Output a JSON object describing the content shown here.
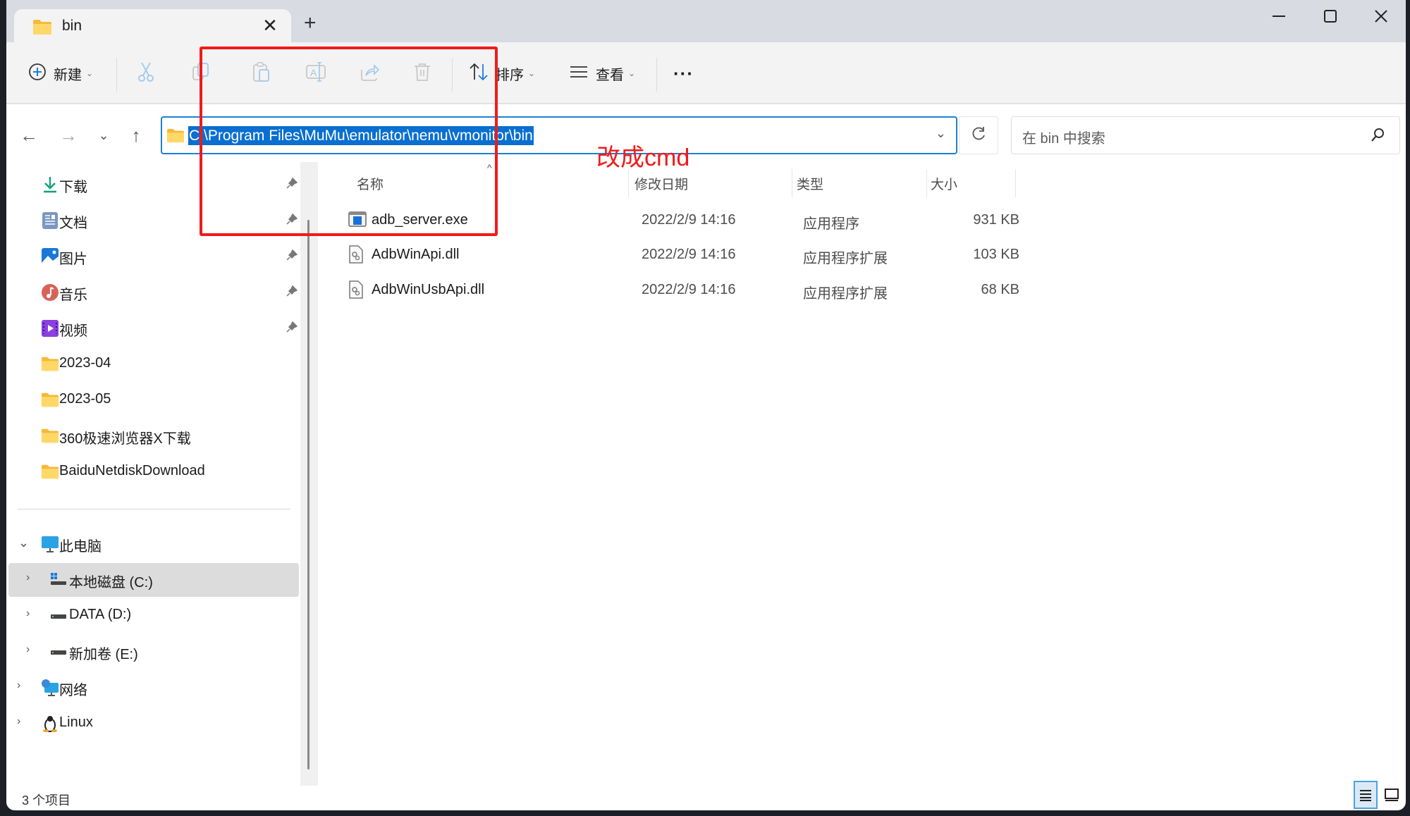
{
  "tab": {
    "title": "bin",
    "close_glyph": "✕",
    "new_glyph": "+"
  },
  "window_controls": {
    "minimize": "minimize",
    "maximize": "maximize",
    "close": "close"
  },
  "toolbar": {
    "new_label": "新建",
    "sort_label": "排序",
    "view_label": "查看",
    "more_label": "···",
    "caret": "⌄",
    "icons": [
      "cut-icon",
      "copy-icon",
      "paste-icon",
      "rename-icon",
      "share-icon",
      "delete-icon"
    ]
  },
  "nav": {
    "back": "←",
    "forward": "→",
    "recent": "⌄",
    "up": "↑",
    "address": "C:\\Program Files\\MuMu\\emulator\\nemu\\vmonitor\\bin",
    "dropdown": "⌄",
    "search_placeholder": "在 bin 中搜索"
  },
  "sidebar": {
    "quick_access": [
      {
        "label": "下载",
        "icon": "download-icon",
        "pinned": true
      },
      {
        "label": "文档",
        "icon": "documents-icon",
        "pinned": true
      },
      {
        "label": "图片",
        "icon": "pictures-icon",
        "pinned": true
      },
      {
        "label": "音乐",
        "icon": "music-icon",
        "pinned": true
      },
      {
        "label": "视频",
        "icon": "videos-icon",
        "pinned": true
      },
      {
        "label": "2023-04",
        "icon": "folder-icon",
        "pinned": false
      },
      {
        "label": "2023-05",
        "icon": "folder-icon",
        "pinned": false
      },
      {
        "label": "360极速浏览器X下载",
        "icon": "folder-icon",
        "pinned": false
      },
      {
        "label": "BaiduNetdiskDownload",
        "icon": "folder-icon",
        "pinned": false
      }
    ],
    "this_pc": {
      "label": "此电脑",
      "expanded": true
    },
    "drives": [
      {
        "label": "本地磁盘 (C:)",
        "selected": true
      },
      {
        "label": "DATA (D:)",
        "selected": false
      },
      {
        "label": "新加卷 (E:)",
        "selected": false
      }
    ],
    "network": {
      "label": "网络"
    },
    "linux": {
      "label": "Linux"
    }
  },
  "columns": {
    "name": "名称",
    "modified": "修改日期",
    "type": "类型",
    "size": "大小"
  },
  "files": [
    {
      "name": "adb_server.exe",
      "modified": "2022/2/9 14:16",
      "type": "应用程序",
      "size": "931 KB",
      "icon": "exe-icon"
    },
    {
      "name": "AdbWinApi.dll",
      "modified": "2022/2/9 14:16",
      "type": "应用程序扩展",
      "size": "103 KB",
      "icon": "dll-icon"
    },
    {
      "name": "AdbWinUsbApi.dll",
      "modified": "2022/2/9 14:16",
      "type": "应用程序扩展",
      "size": "68 KB",
      "icon": "dll-icon"
    }
  ],
  "status": {
    "item_count": "3 个项目"
  },
  "annotation": {
    "text": "改成cmd",
    "color": "#f11a1a"
  },
  "colors": {
    "accent": "#0a6fd0",
    "folder": "#f7c948",
    "selection_bg": "#dcdcdc"
  }
}
